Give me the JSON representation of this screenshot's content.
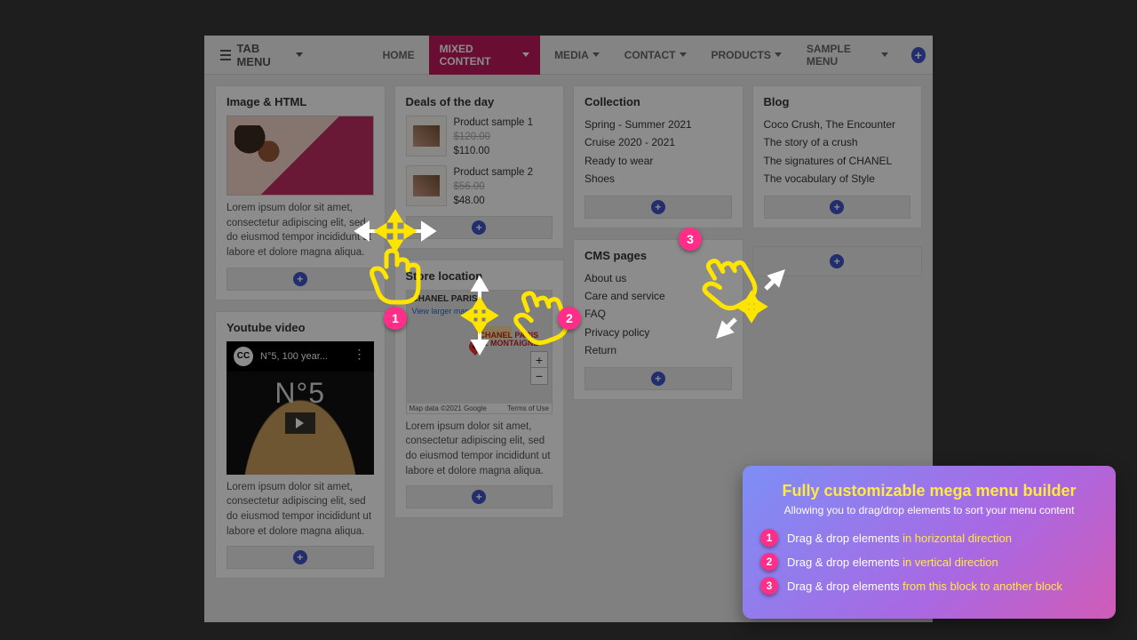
{
  "topbar": {
    "tabmenu_label": "TAB MENU",
    "items": [
      {
        "label": "HOME"
      },
      {
        "label": "MIXED CONTENT",
        "active": true
      },
      {
        "label": "MEDIA"
      },
      {
        "label": "CONTACT"
      },
      {
        "label": "PRODUCTS"
      },
      {
        "label": "SAMPLE MENU"
      }
    ]
  },
  "cols": {
    "image_html": {
      "title": "Image & HTML",
      "text": "Lorem ipsum dolor sit amet, consectetur adipiscing elit, sed do eiusmod tempor incididunt ut labore et dolore magna aliqua."
    },
    "deals": {
      "title": "Deals of the day",
      "products": [
        {
          "name": "Product sample 1",
          "old": "$120.00",
          "price": "$110.00"
        },
        {
          "name": "Product sample 2",
          "old": "$56.00",
          "price": "$48.00"
        }
      ]
    },
    "collection": {
      "title": "Collection",
      "links": [
        "Spring - Summer 2021",
        "Cruise 2020 - 2021",
        "Ready to wear",
        "Shoes"
      ]
    },
    "blog": {
      "title": "Blog",
      "links": [
        "Coco Crush, The Encounter",
        "The story of a crush",
        "The signatures of CHANEL",
        "The vocabulary of Style"
      ]
    },
    "youtube": {
      "title": "Youtube video",
      "video_title": "N°5, 100 year...",
      "big": "N°5",
      "text": "Lorem ipsum dolor sit amet, consectetur adipiscing elit, sed do eiusmod tempor incididunt ut labore et dolore magna aliqua."
    },
    "store": {
      "title": "Store location",
      "map_title": "CHANEL PARIS",
      "map_link": "View larger map",
      "map_label": "CHANEL PARIS\n51 MONTAIGNE",
      "attr_left": "Map data ©2021 Google",
      "attr_right": "Terms of Use",
      "text": "Lorem ipsum dolor sit amet, consectetur adipiscing elit, sed do eiusmod tempor incididunt ut labore et dolore magna aliqua."
    },
    "cms": {
      "title": "CMS pages",
      "links": [
        "About us",
        "Care and service",
        "FAQ",
        "Privacy policy",
        "Return"
      ]
    }
  },
  "panel": {
    "title": "Fully customizable mega menu builder",
    "subtitle": "Allowing you to drag/drop elements to sort your menu content",
    "items": [
      {
        "num": "1",
        "text": "Drag & drop elements ",
        "hl": "in horizontal direction"
      },
      {
        "num": "2",
        "text": "Drag & drop elements ",
        "hl": "in vertical direction"
      },
      {
        "num": "3",
        "text": "Drag & drop elements ",
        "hl": "from this block to another block"
      }
    ]
  }
}
